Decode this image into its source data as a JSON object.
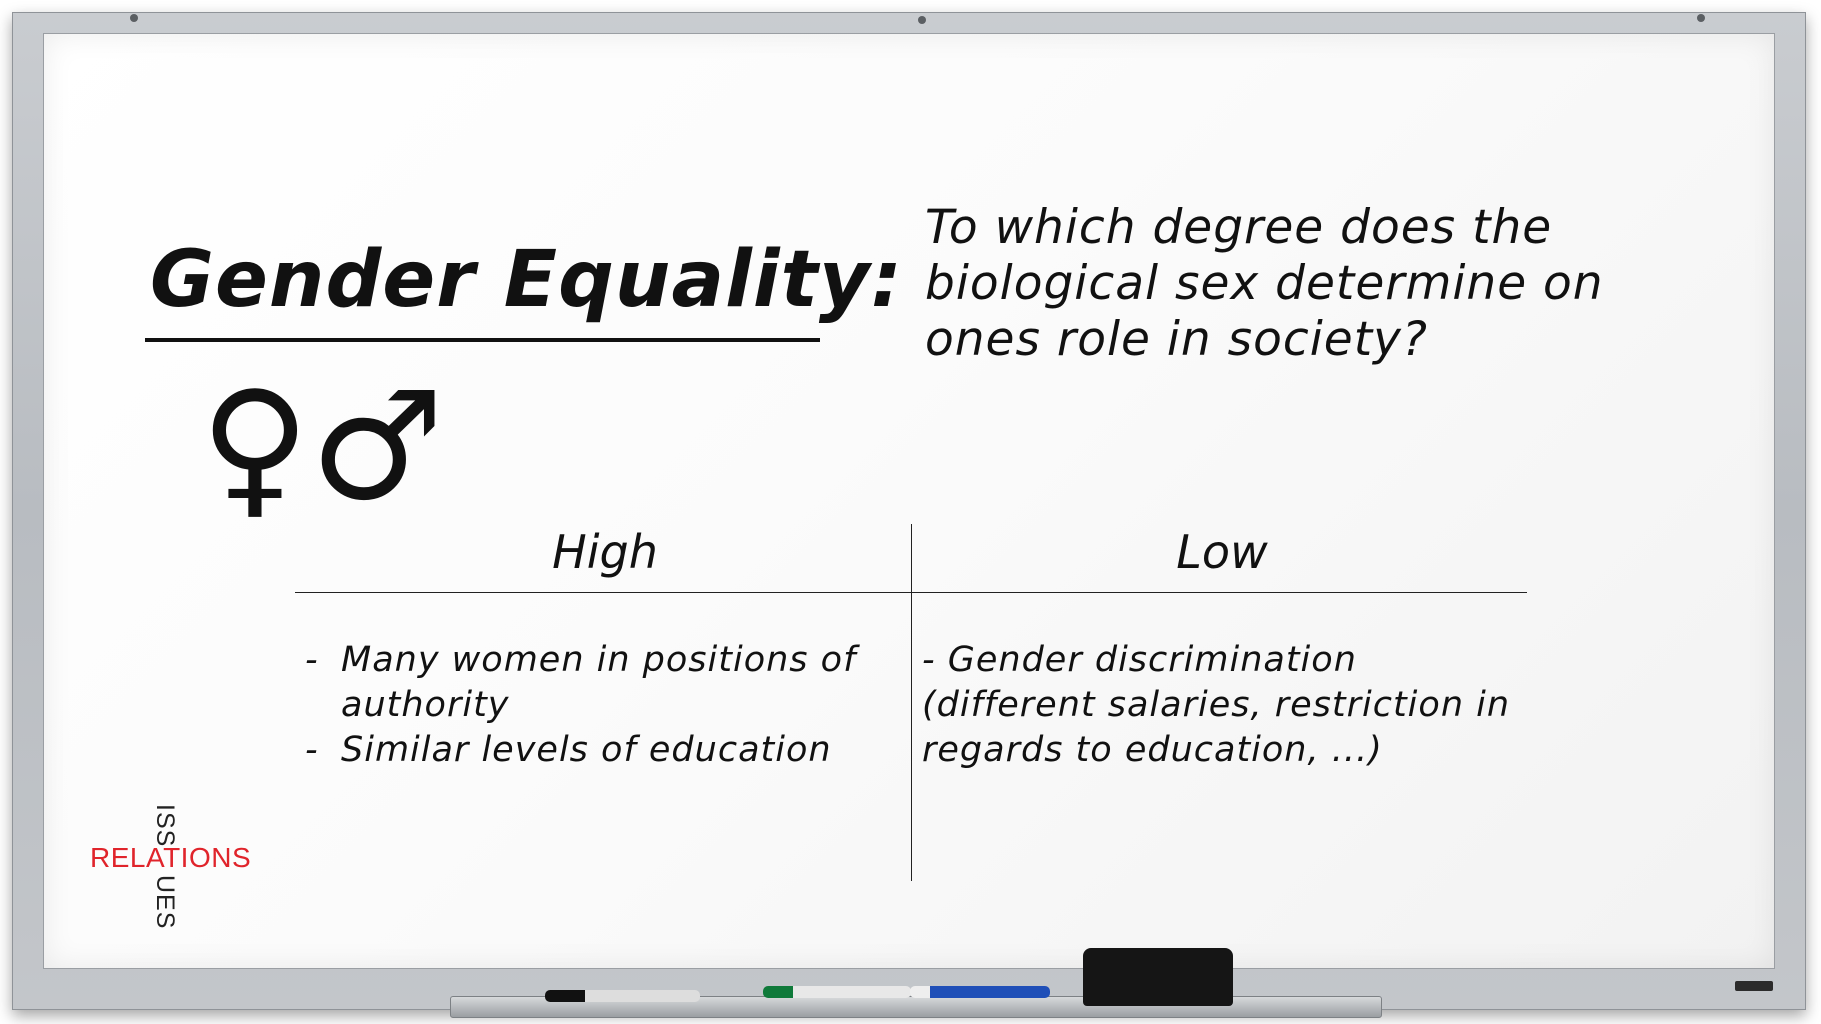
{
  "slide": {
    "title": "Gender Equality:",
    "question": "To which degree does the biological sex determine on ones role in society?",
    "symbols": "♀♂",
    "columns": {
      "high": {
        "heading": "High",
        "items": [
          "Many women in positions of authority",
          "Similar levels of education"
        ]
      },
      "low": {
        "heading": "Low",
        "text_line1": "- Gender discrimination",
        "text_line2": "(different salaries, restriction in",
        "text_line3": "regards to education, ...)"
      }
    }
  },
  "logo": {
    "top": "ISS",
    "main": "RELATIONS",
    "bottom": "UES",
    "accent_color": "#e0242b"
  }
}
